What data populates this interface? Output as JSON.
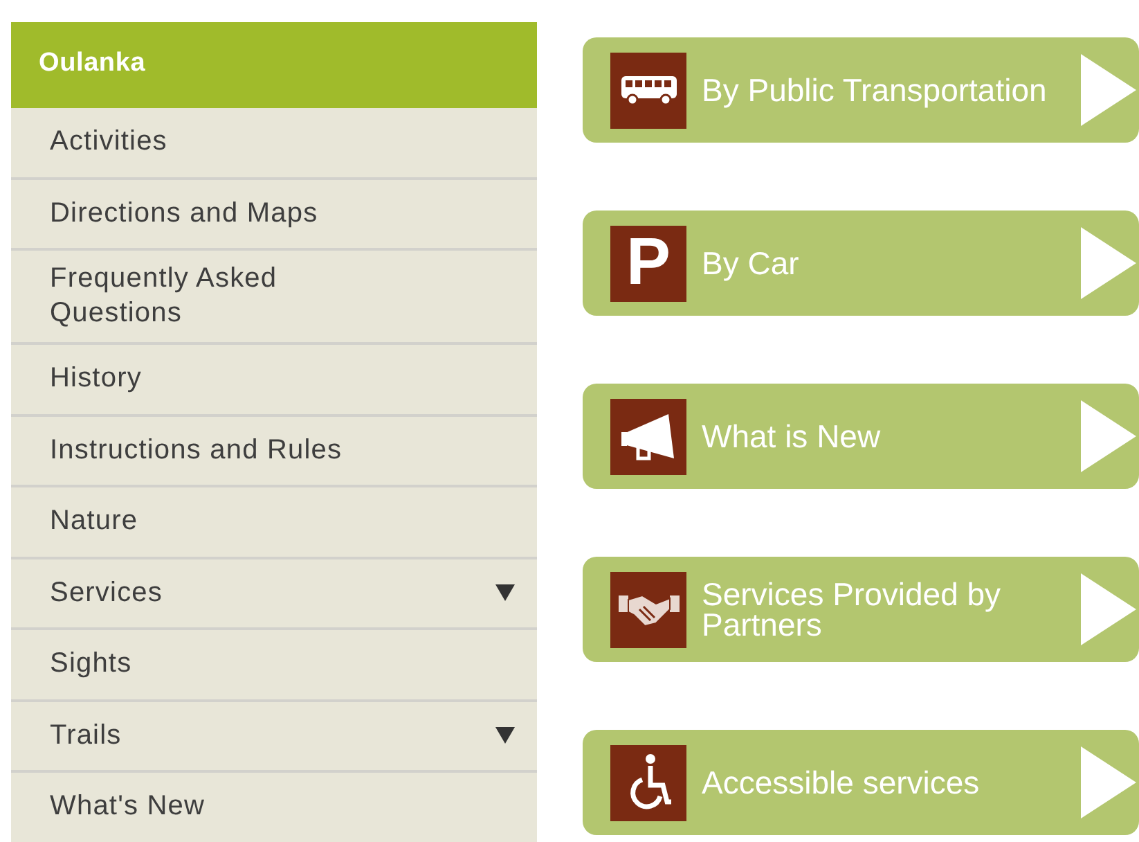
{
  "sidebar": {
    "title": "Oulanka",
    "items": [
      {
        "label": "Activities",
        "has_submenu": false
      },
      {
        "label": "Directions and Maps",
        "has_submenu": false
      },
      {
        "label": "Frequently Asked Questions",
        "has_submenu": false
      },
      {
        "label": "History",
        "has_submenu": false
      },
      {
        "label": "Instructions and Rules",
        "has_submenu": false
      },
      {
        "label": "Nature",
        "has_submenu": false
      },
      {
        "label": "Services",
        "has_submenu": true
      },
      {
        "label": "Sights",
        "has_submenu": false
      },
      {
        "label": "Trails",
        "has_submenu": true
      },
      {
        "label": "What's New",
        "has_submenu": false
      }
    ]
  },
  "links": [
    {
      "kind": "bus",
      "label": "By Public Transportation"
    },
    {
      "kind": "letter",
      "icon_text": "P",
      "label": "By Car"
    },
    {
      "kind": "megaphone",
      "label": "What is New"
    },
    {
      "kind": "handshake",
      "label": "Services Provided by Partners"
    },
    {
      "kind": "wheelchair",
      "label": "Accessible services"
    }
  ]
}
